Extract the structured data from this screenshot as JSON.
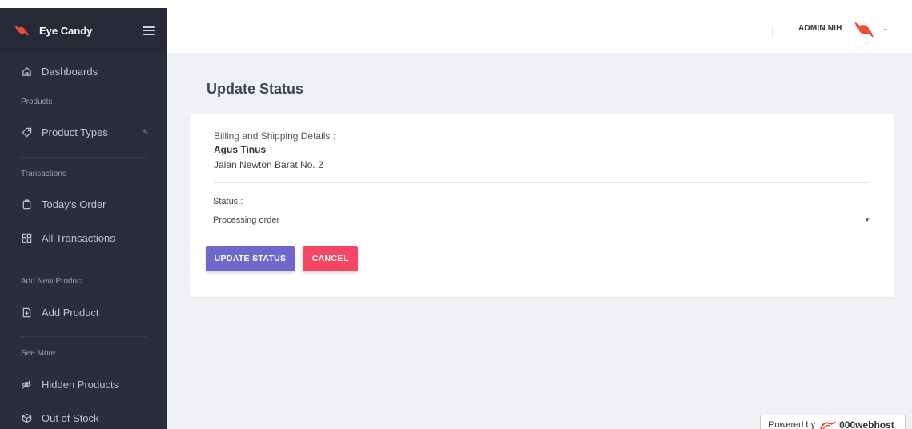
{
  "app": {
    "brand_name": "Eye Candy",
    "logo_icon": "candy-icon",
    "accent_color": "#6f67c9",
    "danger_color": "#f64663"
  },
  "sidebar": {
    "items": [
      {
        "label": "Dashboards",
        "icon": "home-icon"
      },
      {
        "section": "Products"
      },
      {
        "label": "Product Types",
        "icon": "tag-icon",
        "caret": "<"
      },
      {
        "section": "Transactions"
      },
      {
        "label": "Today's Order",
        "icon": "clipboard-icon"
      },
      {
        "label": "All Transactions",
        "icon": "grid-icon"
      },
      {
        "section": "Add New Product"
      },
      {
        "label": "Add Product",
        "icon": "file-plus-icon"
      },
      {
        "section": "See More"
      },
      {
        "label": "Hidden Products",
        "icon": "eye-off-icon"
      },
      {
        "label": "Out of Stock",
        "icon": "box-icon"
      }
    ]
  },
  "header": {
    "user_name": "ADMIN NIH",
    "chevron": "⌄"
  },
  "main": {
    "page_title": "Update Status",
    "billing_label": "Billing and Shipping Details :",
    "customer_name": "Agus Tinus",
    "customer_address": "Jalan Newton Barat No. 2",
    "status_label": "Status :",
    "status_value": "Processing order",
    "update_button": "UPDATE STATUS",
    "cancel_button": "CANCEL"
  },
  "footer": {
    "powered_by": "Powered by",
    "host_name": "000webhost"
  }
}
